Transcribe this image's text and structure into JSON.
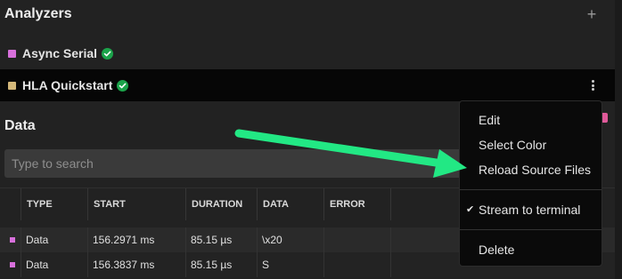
{
  "analyzers_panel": {
    "title": "Analyzers",
    "add_icon": "plus-icon",
    "items": [
      {
        "label": "Async Serial",
        "color": "#d870dc",
        "status_icon": "check-circle-icon",
        "status_color": "#1ba34a"
      },
      {
        "label": "HLA Quickstart",
        "color": "#d4b87a",
        "status_icon": "check-circle-icon",
        "status_color": "#1ba34a"
      }
    ],
    "more_icon": "kebab-menu-icon"
  },
  "data_panel": {
    "title": "Data",
    "search_placeholder": "Type to search",
    "columns": [
      "TYPE",
      "START",
      "DURATION",
      "DATA",
      "ERROR"
    ],
    "rows": [
      {
        "type": "Data",
        "start": "156.2971 ms",
        "duration": "85.15 µs",
        "data": "\\x20",
        "error": ""
      },
      {
        "type": "Data",
        "start": "156.3837 ms",
        "duration": "85.15 µs",
        "data": "S",
        "error": ""
      }
    ]
  },
  "context_menu": {
    "items": [
      {
        "label": "Edit"
      },
      {
        "label": "Select Color"
      },
      {
        "label": "Reload Source Files"
      },
      {
        "label": "Stream to terminal",
        "checked": true
      },
      {
        "label": "Delete"
      }
    ]
  },
  "annotation": {
    "type": "arrow",
    "color": "#22e884",
    "icon": "annotation-arrow"
  },
  "colors": {
    "background": "#222222",
    "menu_background": "#0a0a0a",
    "search_background": "#3a3a3a"
  }
}
